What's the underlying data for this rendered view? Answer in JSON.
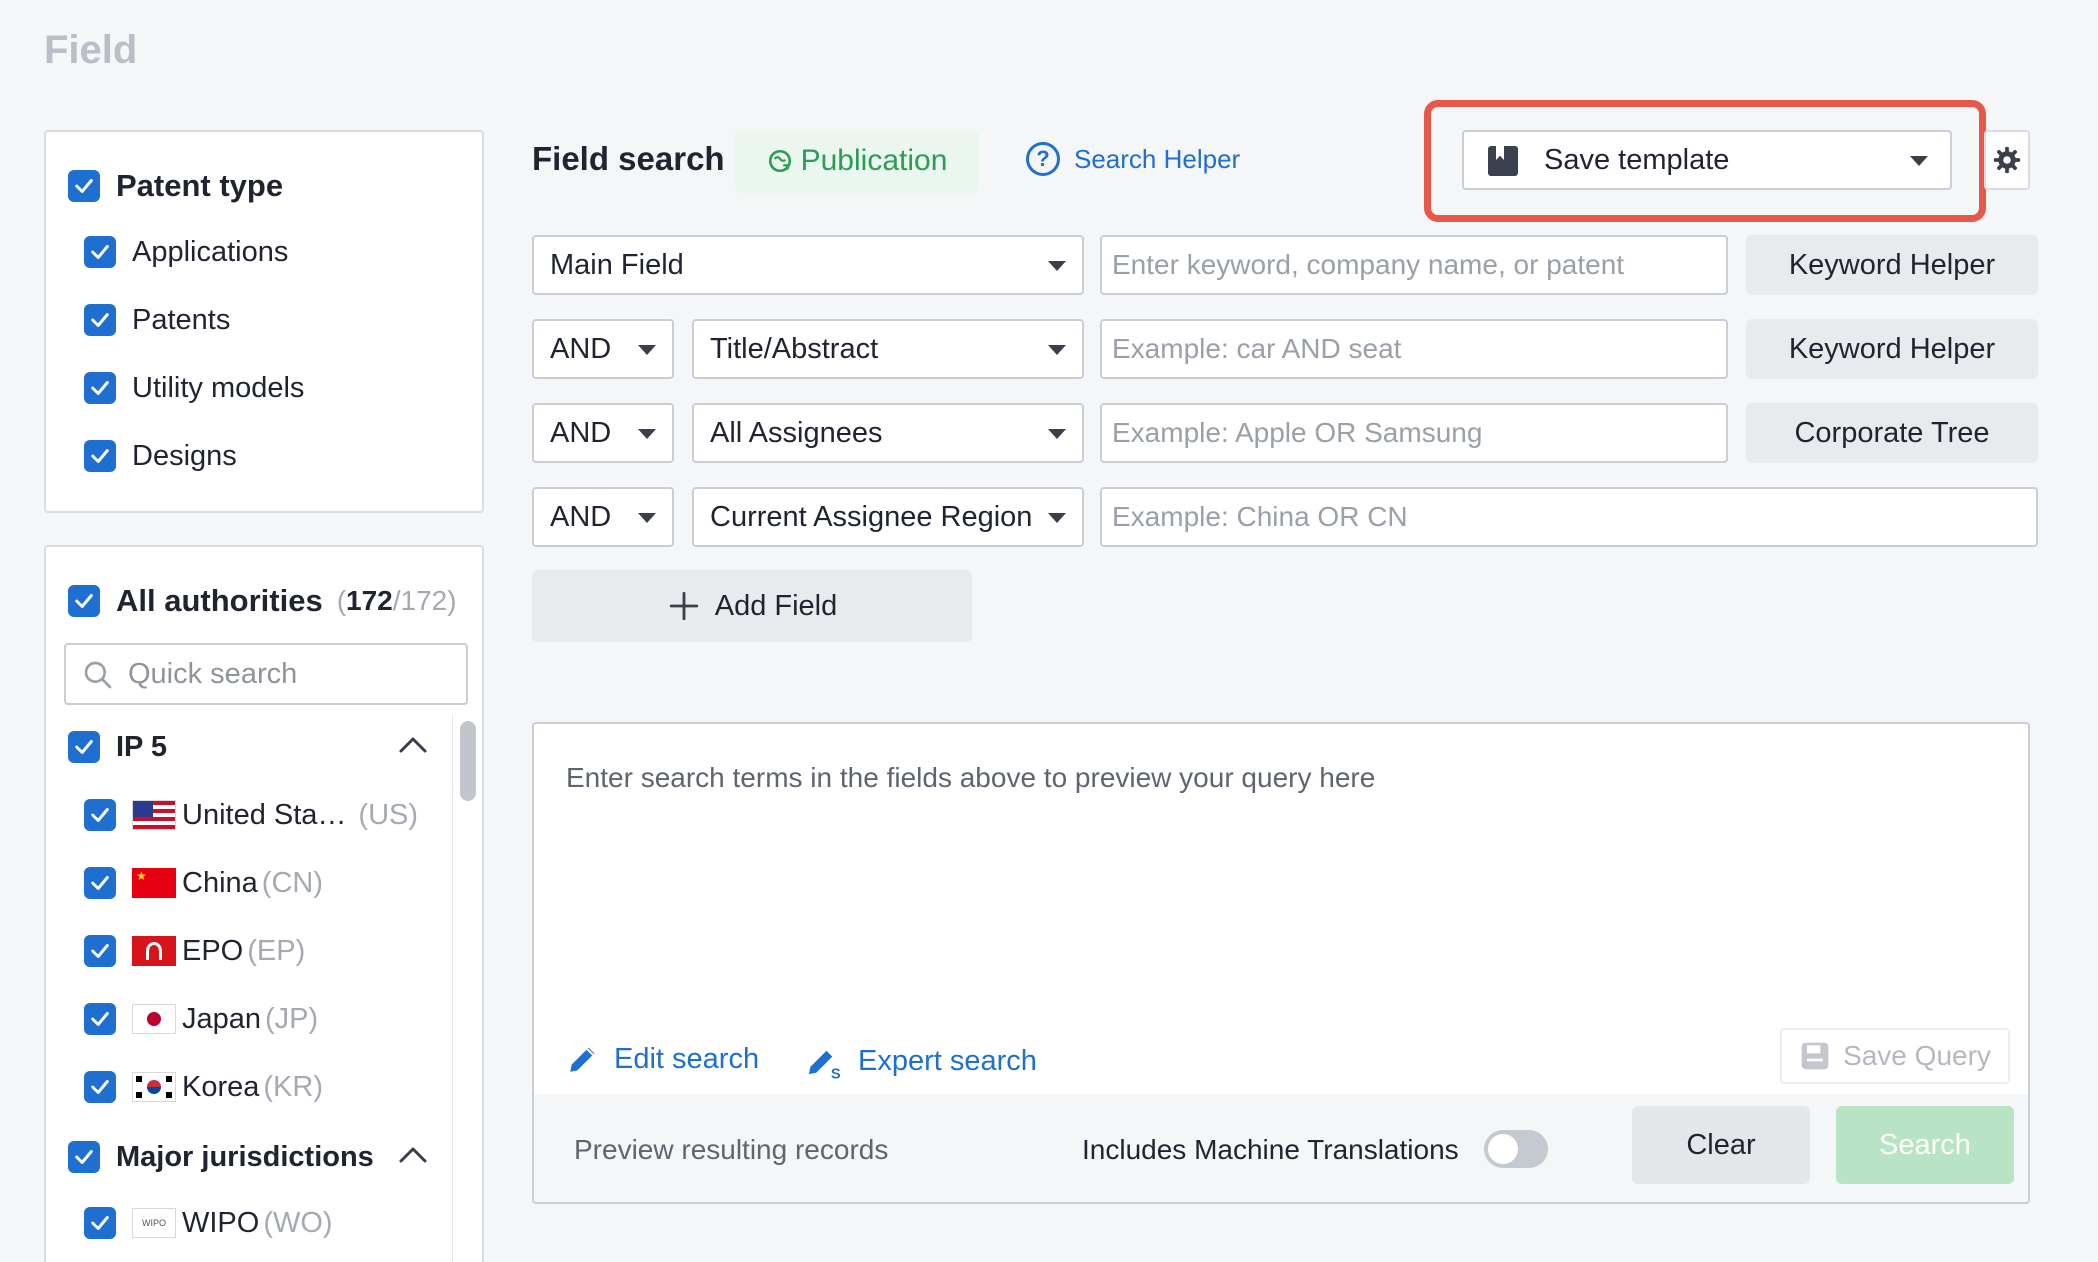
{
  "page": {
    "title": "Field"
  },
  "patent_types": {
    "header": "Patent type",
    "items": [
      {
        "label": "Applications"
      },
      {
        "label": "Patents"
      },
      {
        "label": "Utility models"
      },
      {
        "label": "Designs"
      }
    ]
  },
  "authorities": {
    "header": "All authorities",
    "count_selected": "172",
    "count_total": "/172)",
    "count_open": "(",
    "quick_search_placeholder": "Quick search",
    "groups": [
      {
        "label": "IP 5",
        "items": [
          {
            "label": "United Sta…",
            "code": "(US)",
            "flag": "us-flag"
          },
          {
            "label": "China",
            "code": "(CN)",
            "flag": "cn-flag"
          },
          {
            "label": "EPO",
            "code": "(EP)",
            "flag": "ep-flag"
          },
          {
            "label": "Japan",
            "code": "(JP)",
            "flag": "jp-flag"
          },
          {
            "label": "Korea",
            "code": "(KR)",
            "flag": "kr-flag"
          }
        ]
      },
      {
        "label": "Major jurisdictions",
        "items": [
          {
            "label": "WIPO",
            "code": "(WO)",
            "flag": "wipo-flag",
            "flag_text": "WIPO"
          }
        ]
      }
    ]
  },
  "field_search": {
    "label": "Field search",
    "badge": "Publication",
    "helper_link": "Search Helper",
    "template_select": "Save template",
    "rows": [
      {
        "field": "Main Field",
        "placeholder": "Enter keyword, company name, or patent",
        "button": "Keyword Helper"
      },
      {
        "operator": "AND",
        "field": "Title/Abstract",
        "placeholder": "Example: car AND seat",
        "button": "Keyword Helper"
      },
      {
        "operator": "AND",
        "field": "All Assignees",
        "placeholder": "Example: Apple OR Samsung",
        "button": "Corporate Tree"
      },
      {
        "operator": "AND",
        "field": "Current Assignee Region",
        "placeholder": "Example: China OR CN"
      }
    ],
    "add_field": "Add Field"
  },
  "preview": {
    "placeholder": "Enter search terms in the fields above to preview your query here",
    "edit_search": "Edit search",
    "expert_search": "Expert search",
    "save_query": "Save Query",
    "preview_records": "Preview resulting records",
    "machine_translations": "Includes Machine Translations",
    "machine_translations_on": false,
    "clear": "Clear",
    "search": "Search"
  },
  "colors": {
    "accent": "#1f6fd1",
    "publication_green": "#2a9d52",
    "highlight_red": "#e8584a",
    "search_disabled": "#b8e3c4"
  }
}
